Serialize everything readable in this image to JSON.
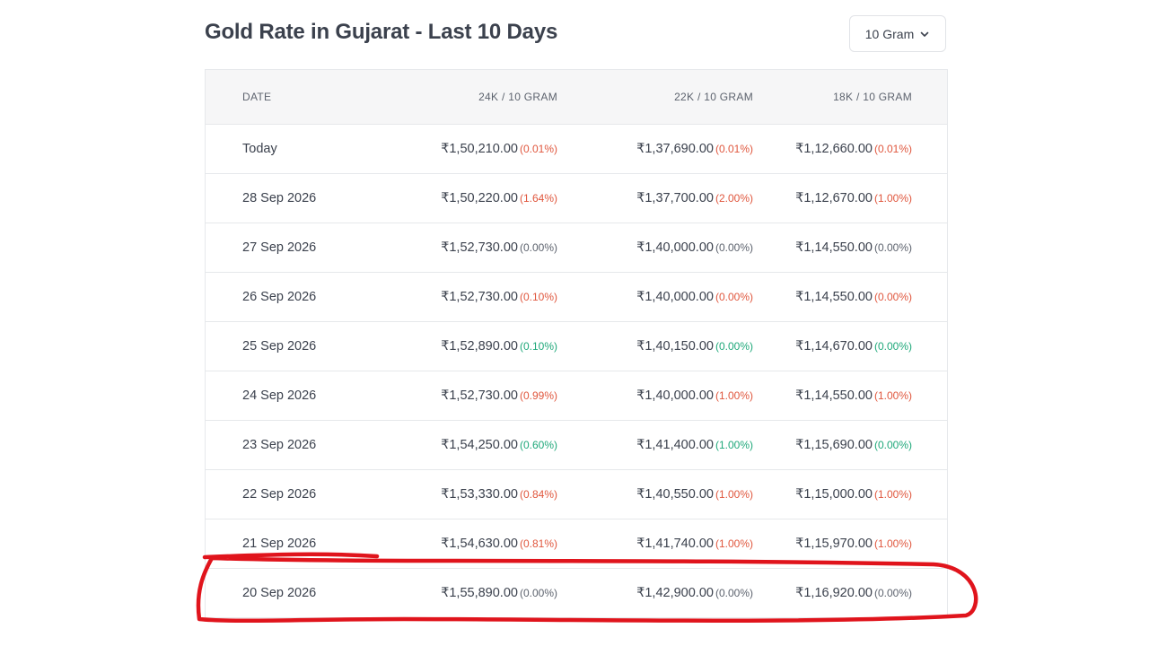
{
  "header": {
    "title": "Gold Rate in Gujarat - Last 10 Days",
    "unit_select": "10 Gram"
  },
  "table": {
    "columns": [
      "DATE",
      "24K / 10 GRAM",
      "22K / 10 GRAM",
      "18K / 10 GRAM"
    ],
    "rows": [
      {
        "date": "Today",
        "k24": "₹1,50,210.00",
        "k24_chg": "(0.01%)",
        "k22": "₹1,37,690.00",
        "k22_chg": "(0.01%)",
        "k18": "₹1,12,660.00",
        "k18_chg": "(0.01%)",
        "k24_dir": "down",
        "k22_dir": "down",
        "k18_dir": "down"
      },
      {
        "date": "28 Sep 2026",
        "k24": "₹1,50,220.00",
        "k24_chg": "(1.64%)",
        "k22": "₹1,37,700.00",
        "k22_chg": "(2.00%)",
        "k18": "₹1,12,670.00",
        "k18_chg": "(1.00%)",
        "k24_dir": "down",
        "k22_dir": "down",
        "k18_dir": "down"
      },
      {
        "date": "27 Sep 2026",
        "k24": "₹1,52,730.00",
        "k24_chg": "(0.00%)",
        "k22": "₹1,40,000.00",
        "k22_chg": "(0.00%)",
        "k18": "₹1,14,550.00",
        "k18_chg": "(0.00%)",
        "k24_dir": "flat",
        "k22_dir": "flat",
        "k18_dir": "flat"
      },
      {
        "date": "26 Sep 2026",
        "k24": "₹1,52,730.00",
        "k24_chg": "(0.10%)",
        "k22": "₹1,40,000.00",
        "k22_chg": "(0.00%)",
        "k18": "₹1,14,550.00",
        "k18_chg": "(0.00%)",
        "k24_dir": "down",
        "k22_dir": "down",
        "k18_dir": "down"
      },
      {
        "date": "25 Sep 2026",
        "k24": "₹1,52,890.00",
        "k24_chg": "(0.10%)",
        "k22": "₹1,40,150.00",
        "k22_chg": "(0.00%)",
        "k18": "₹1,14,670.00",
        "k18_chg": "(0.00%)",
        "k24_dir": "up",
        "k22_dir": "up",
        "k18_dir": "up"
      },
      {
        "date": "24 Sep 2026",
        "k24": "₹1,52,730.00",
        "k24_chg": "(0.99%)",
        "k22": "₹1,40,000.00",
        "k22_chg": "(1.00%)",
        "k18": "₹1,14,550.00",
        "k18_chg": "(1.00%)",
        "k24_dir": "down",
        "k22_dir": "down",
        "k18_dir": "down"
      },
      {
        "date": "23 Sep 2026",
        "k24": "₹1,54,250.00",
        "k24_chg": "(0.60%)",
        "k22": "₹1,41,400.00",
        "k22_chg": "(1.00%)",
        "k18": "₹1,15,690.00",
        "k18_chg": "(0.00%)",
        "k24_dir": "up",
        "k22_dir": "up",
        "k18_dir": "up"
      },
      {
        "date": "22 Sep 2026",
        "k24": "₹1,53,330.00",
        "k24_chg": "(0.84%)",
        "k22": "₹1,40,550.00",
        "k22_chg": "(1.00%)",
        "k18": "₹1,15,000.00",
        "k18_chg": "(1.00%)",
        "k24_dir": "down",
        "k22_dir": "down",
        "k18_dir": "down"
      },
      {
        "date": "21 Sep 2026",
        "k24": "₹1,54,630.00",
        "k24_chg": "(0.81%)",
        "k22": "₹1,41,740.00",
        "k22_chg": "(1.00%)",
        "k18": "₹1,15,970.00",
        "k18_chg": "(1.00%)",
        "k24_dir": "down",
        "k22_dir": "down",
        "k18_dir": "down"
      },
      {
        "date": "20 Sep 2026",
        "k24": "₹1,55,890.00",
        "k24_chg": "(0.00%)",
        "k22": "₹1,42,900.00",
        "k22_chg": "(0.00%)",
        "k18": "₹1,16,920.00",
        "k18_chg": "(0.00%)",
        "k24_dir": "flat",
        "k22_dir": "flat",
        "k18_dir": "flat"
      }
    ]
  },
  "colors": {
    "down": "#e0573e",
    "up": "#1fa87a",
    "highlight_stroke": "#e0141c"
  },
  "icons": {
    "unit_select_chevron": "chevron-down-icon"
  }
}
